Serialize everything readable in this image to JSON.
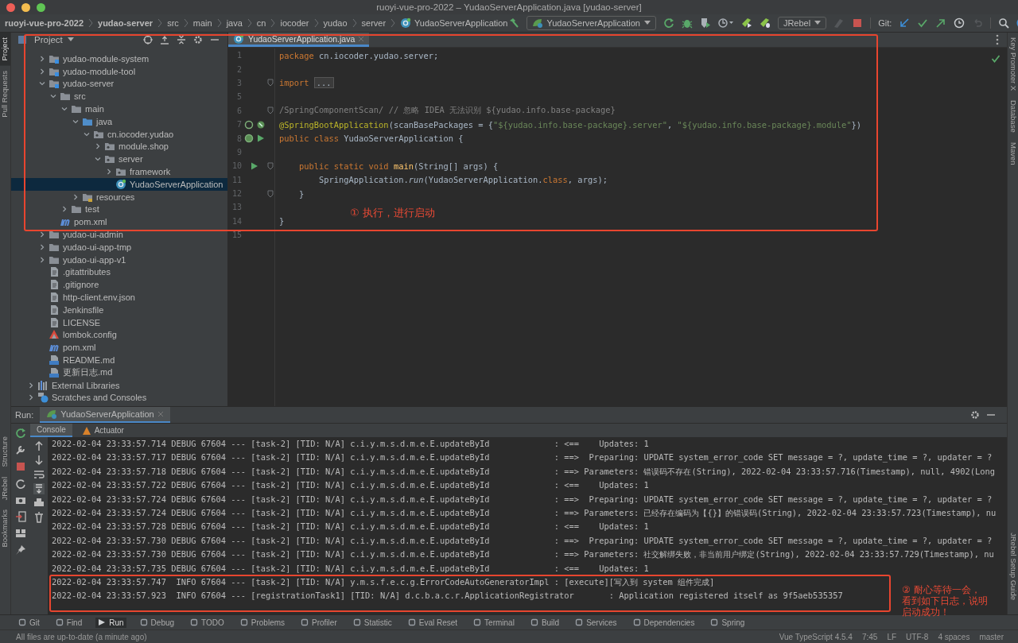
{
  "window": {
    "title": "ruoyi-vue-pro-2022 – YudaoServerApplication.java [yudao-server]"
  },
  "breadcrumbs": [
    {
      "label": "ruoyi-vue-pro-2022",
      "kind": "module"
    },
    {
      "label": "yudao-server",
      "kind": "module"
    },
    {
      "label": "src",
      "kind": "folder"
    },
    {
      "label": "main",
      "kind": "folder"
    },
    {
      "label": "java",
      "kind": "folder"
    },
    {
      "label": "cn",
      "kind": "folder"
    },
    {
      "label": "iocoder",
      "kind": "folder"
    },
    {
      "label": "yudao",
      "kind": "folder"
    },
    {
      "label": "server",
      "kind": "folder"
    },
    {
      "label": "YudaoServerApplication",
      "kind": "class"
    }
  ],
  "toolbar": {
    "run_config": "YudaoServerApplication",
    "jrebel": "JRebel",
    "git_label": "Git:"
  },
  "left_stripe": [
    {
      "label": "Project",
      "selected": true
    },
    {
      "label": "Pull Requests",
      "selected": false
    },
    {
      "label": "Structure",
      "selected": false
    },
    {
      "label": "JRebel",
      "selected": false
    },
    {
      "label": "Bookmarks",
      "selected": false
    }
  ],
  "right_stripe": [
    "Key Promoter X",
    "Database",
    "Maven",
    "JRebel Setup Guide"
  ],
  "project": {
    "title": "Project",
    "items": [
      {
        "label": "yudao-module-system",
        "kind": "module",
        "expanded": false,
        "selected": false
      },
      {
        "label": "yudao-module-tool",
        "kind": "module",
        "expanded": false,
        "selected": false
      },
      {
        "label": "yudao-server",
        "kind": "module",
        "expanded": true,
        "selected": false,
        "children": [
          {
            "label": "src",
            "kind": "folder",
            "expanded": true,
            "selected": false,
            "children": [
              {
                "label": "main",
                "kind": "folder",
                "expanded": true,
                "selected": false,
                "children": [
                  {
                    "label": "java",
                    "kind": "source",
                    "expanded": true,
                    "selected": false,
                    "children": [
                      {
                        "label": "cn.iocoder.yudao",
                        "kind": "package",
                        "expanded": true,
                        "selected": false,
                        "children": [
                          {
                            "label": "module.shop",
                            "kind": "package",
                            "expanded": false,
                            "selected": false
                          },
                          {
                            "label": "server",
                            "kind": "package",
                            "expanded": true,
                            "selected": false,
                            "children": [
                              {
                                "label": "framework",
                                "kind": "package",
                                "expanded": false,
                                "selected": false
                              },
                              {
                                "label": "YudaoServerApplication",
                                "kind": "class",
                                "selected": true
                              }
                            ]
                          }
                        ]
                      }
                    ]
                  },
                  {
                    "label": "resources",
                    "kind": "resources",
                    "expanded": false,
                    "selected": false
                  }
                ]
              },
              {
                "label": "test",
                "kind": "folder",
                "expanded": false,
                "selected": false
              }
            ]
          },
          {
            "label": "pom.xml",
            "kind": "maven",
            "selected": false
          }
        ]
      },
      {
        "label": "yudao-ui-admin",
        "kind": "folder",
        "expanded": false,
        "selected": false
      },
      {
        "label": "yudao-ui-app-tmp",
        "kind": "folder",
        "expanded": false,
        "selected": false
      },
      {
        "label": "yudao-ui-app-v1",
        "kind": "folder",
        "expanded": false,
        "selected": false
      },
      {
        "label": ".gitattributes",
        "kind": "file",
        "selected": false
      },
      {
        "label": ".gitignore",
        "kind": "file",
        "selected": false
      },
      {
        "label": "http-client.env.json",
        "kind": "file",
        "selected": false
      },
      {
        "label": "Jenkinsfile",
        "kind": "file",
        "selected": false
      },
      {
        "label": "LICENSE",
        "kind": "file",
        "selected": false
      },
      {
        "label": "lombok.config",
        "kind": "config",
        "selected": false
      },
      {
        "label": "pom.xml",
        "kind": "maven",
        "selected": false
      },
      {
        "label": "README.md",
        "kind": "markdown",
        "selected": false
      },
      {
        "label": "更新日志.md",
        "kind": "markdown",
        "selected": false
      }
    ],
    "roots": [
      {
        "label": "External Libraries",
        "kind": "libraries",
        "expanded": false,
        "selected": false
      },
      {
        "label": "Scratches and Consoles",
        "kind": "scratches",
        "expanded": false,
        "selected": false
      }
    ]
  },
  "editor": {
    "tab": "YudaoServerApplication.java",
    "lines": [
      {
        "number": "1",
        "fold": false,
        "bean": false,
        "autowired": false,
        "run_marker": false,
        "tokens": [
          {
            "kind": "keyword",
            "text": "package"
          },
          {
            "kind": "plain",
            "text": " cn.iocoder.yudao.server;"
          }
        ]
      },
      {
        "number": "2",
        "fold": false,
        "bean": false,
        "autowired": false,
        "run_marker": false
      },
      {
        "number": "3",
        "fold": true,
        "bean": false,
        "autowired": false,
        "run_marker": false,
        "tokens": [
          {
            "kind": "keyword",
            "text": "import "
          },
          {
            "kind": "folded",
            "text": "..."
          }
        ]
      },
      {
        "number": "5",
        "fold": false,
        "bean": false,
        "autowired": false,
        "run_marker": false
      },
      {
        "number": "6",
        "fold": true,
        "bean": false,
        "autowired": false,
        "run_marker": false,
        "tokens": [
          {
            "kind": "comment",
            "text": "/SpringComponentScan/ // 忽略 IDEA 无法识别 ${yudao.info.base-package}"
          }
        ]
      },
      {
        "number": "7",
        "fold": false,
        "bean": true,
        "autowired": true,
        "run_marker": false,
        "tokens": [
          {
            "kind": "annotation",
            "text": "@SpringBootApplication"
          },
          {
            "kind": "plain",
            "text": "(scanBasePackages = {"
          },
          {
            "kind": "string",
            "text": "\"${yudao.info.base-package}.server\""
          },
          {
            "kind": "plain",
            "text": ", "
          },
          {
            "kind": "string",
            "text": "\"${yudao.info.base-package}.module\""
          },
          {
            "kind": "plain",
            "text": "})"
          }
        ]
      },
      {
        "number": "8",
        "fold": false,
        "bean": true,
        "autowired": false,
        "run_marker": true,
        "tokens": [
          {
            "kind": "keyword",
            "text": "public class"
          },
          {
            "kind": "plain",
            "text": " YudaoServerApplication {"
          }
        ]
      },
      {
        "number": "9",
        "fold": false,
        "bean": false,
        "autowired": false,
        "run_marker": false
      },
      {
        "number": "10",
        "fold": true,
        "bean": false,
        "autowired": false,
        "run_marker": true,
        "tokens": [
          {
            "kind": "keyword",
            "text": "    public static void "
          },
          {
            "kind": "method",
            "text": "main"
          },
          {
            "kind": "plain",
            "text": "(String[] args) {"
          }
        ]
      },
      {
        "number": "11",
        "fold": false,
        "bean": false,
        "autowired": false,
        "run_marker": false,
        "tokens": [
          {
            "kind": "plain",
            "text": "        SpringApplication."
          },
          {
            "kind": "static",
            "text": "run"
          },
          {
            "kind": "plain",
            "text": "(YudaoServerApplication."
          },
          {
            "kind": "keyword",
            "text": "class"
          },
          {
            "kind": "plain",
            "text": ", args);"
          }
        ]
      },
      {
        "number": "12",
        "fold": true,
        "bean": false,
        "autowired": false,
        "run_marker": false,
        "tokens": [
          {
            "kind": "plain",
            "text": "    }"
          }
        ]
      },
      {
        "number": "13",
        "fold": false,
        "bean": false,
        "autowired": false,
        "run_marker": false
      },
      {
        "number": "14",
        "fold": false,
        "bean": false,
        "autowired": false,
        "run_marker": false,
        "tokens": [
          {
            "kind": "plain",
            "text": "}"
          }
        ]
      },
      {
        "number": "15",
        "fold": false,
        "bean": false,
        "autowired": false,
        "run_marker": false
      }
    ]
  },
  "run": {
    "label": "Run:",
    "tab": "YudaoServerApplication",
    "tabs": [
      {
        "label": "Console",
        "selected": true
      },
      {
        "label": "Actuator",
        "selected": false
      }
    ],
    "lines": [
      "2022-02-04 23:33:57.714 DEBUG 67604 --- [task-2] [TID: N/A] c.i.y.m.s.d.m.e.E.updateById             : <==    Updates: 1",
      "2022-02-04 23:33:57.717 DEBUG 67604 --- [task-2] [TID: N/A] c.i.y.m.s.d.m.e.E.updateById             : ==>  Preparing: UPDATE system_error_code SET message = ?, update_time = ?, updater = ?",
      "2022-02-04 23:33:57.718 DEBUG 67604 --- [task-2] [TID: N/A] c.i.y.m.s.d.m.e.E.updateById             : ==> Parameters: 错误码不存在(String), 2022-02-04 23:33:57.716(Timestamp), null, 4902(Long",
      "2022-02-04 23:33:57.722 DEBUG 67604 --- [task-2] [TID: N/A] c.i.y.m.s.d.m.e.E.updateById             : <==    Updates: 1",
      "2022-02-04 23:33:57.724 DEBUG 67604 --- [task-2] [TID: N/A] c.i.y.m.s.d.m.e.E.updateById             : ==>  Preparing: UPDATE system_error_code SET message = ?, update_time = ?, updater = ?",
      "2022-02-04 23:33:57.724 DEBUG 67604 --- [task-2] [TID: N/A] c.i.y.m.s.d.m.e.E.updateById             : ==> Parameters: 已经存在编码为【{}】的错误码(String), 2022-02-04 23:33:57.723(Timestamp), nu",
      "2022-02-04 23:33:57.728 DEBUG 67604 --- [task-2] [TID: N/A] c.i.y.m.s.d.m.e.E.updateById             : <==    Updates: 1",
      "2022-02-04 23:33:57.730 DEBUG 67604 --- [task-2] [TID: N/A] c.i.y.m.s.d.m.e.E.updateById             : ==>  Preparing: UPDATE system_error_code SET message = ?, update_time = ?, updater = ?",
      "2022-02-04 23:33:57.730 DEBUG 67604 --- [task-2] [TID: N/A] c.i.y.m.s.d.m.e.E.updateById             : ==> Parameters: 社交解绑失败，非当前用户绑定(String), 2022-02-04 23:33:57.729(Timestamp), nu",
      "2022-02-04 23:33:57.735 DEBUG 67604 --- [task-2] [TID: N/A] c.i.y.m.s.d.m.e.E.updateById             : <==    Updates: 1",
      "2022-02-04 23:33:57.747  INFO 67604 --- [task-2] [TID: N/A] y.m.s.f.e.c.g.ErrorCodeAutoGeneratorImpl : [execute][写入到 system 组件完成]",
      "2022-02-04 23:33:57.923  INFO 67604 --- [registrationTask1] [TID: N/A] d.c.b.a.c.r.ApplicationRegistrator       : Application registered itself as 9f5aeb535357"
    ]
  },
  "tool_windows": [
    {
      "label": "Git",
      "selected": false
    },
    {
      "label": "Find",
      "selected": false
    },
    {
      "label": "Run",
      "selected": true
    },
    {
      "label": "Debug",
      "selected": false
    },
    {
      "label": "TODO",
      "selected": false
    },
    {
      "label": "Problems",
      "selected": false
    },
    {
      "label": "Profiler",
      "selected": false
    },
    {
      "label": "Statistic",
      "selected": false
    },
    {
      "label": "Eval Reset",
      "selected": false
    },
    {
      "label": "Terminal",
      "selected": false
    },
    {
      "label": "Build",
      "selected": false
    },
    {
      "label": "Services",
      "selected": false
    },
    {
      "label": "Dependencies",
      "selected": false
    },
    {
      "label": "Spring",
      "selected": false
    }
  ],
  "status_bar": {
    "message": "All files are up-to-date (a minute ago)",
    "items": [
      "Vue TypeScript 4.5.4",
      "7:45",
      "LF",
      "UTF-8",
      "4 spaces",
      "master"
    ]
  },
  "annotations": [
    {
      "kind": "editor",
      "lines": [
        "① 执行，进行启动"
      ]
    },
    {
      "kind": "console",
      "lines": [
        "② 耐心等待一会，",
        "看到如下日志，说明",
        "启动成功！"
      ]
    }
  ]
}
